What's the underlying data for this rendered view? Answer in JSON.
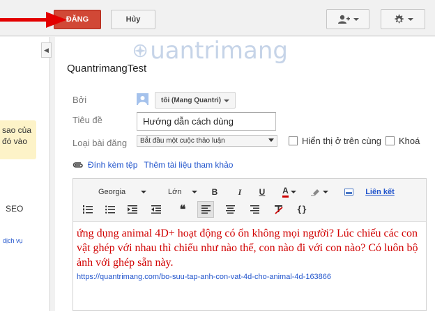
{
  "topbar": {
    "post_label": "ĐĂNG",
    "cancel_label": "Hủy"
  },
  "left": {
    "note_text": "sao của đó vào",
    "seo_text": "SEO",
    "service_text": "dịch vụ"
  },
  "watermark": {
    "text": "uantrimang"
  },
  "group_title": "QuantrimangTest",
  "form": {
    "by_label": "Bởi",
    "author_value": "tôi (Mang Quantri)",
    "title_label": "Tiêu đề",
    "title_value": "Hướng dẫn cách dùng",
    "type_label": "Loại bài đăng",
    "type_value": "Bắt đầu một cuộc thảo luận",
    "pin_label": "Hiển thị ở trên cùng",
    "lock_label": "Khoá",
    "attach_label": "Đính kèm tệp",
    "add_resource_label": "Thêm tài liệu tham khảo"
  },
  "toolbar": {
    "font_family": "Georgia",
    "font_size": "Lớn",
    "bold": "B",
    "italic": "I",
    "underline": "U",
    "text_color": "A",
    "link": "Liên kết",
    "quote": "❝",
    "code": "{}"
  },
  "editor": {
    "body_text": "ứng dụng animal 4D+ hoạt động có ổn không mọi người? Lúc chiếu các con vật ghép với nhau thì chiếu như nào thế, con nào đi với con nào? Có luôn bộ ảnh với ghép sẵn này.",
    "body_link": "https://quantrimang.com/bo-suu-tap-anh-con-vat-4d-cho-animal-4d-163866"
  },
  "colors": {
    "post_button": "#d14836",
    "arrow": "#e30000",
    "body_text": "#d10000",
    "link": "#2255cc"
  },
  "icons": [
    "arrow-right-icon",
    "add-person-icon",
    "gear-icon",
    "chevron-left-icon",
    "avatar-icon",
    "paperclip-icon",
    "numbered-list-icon",
    "bulleted-list-icon",
    "indent-icon",
    "outdent-icon",
    "quote-icon",
    "align-left-icon",
    "align-center-icon",
    "align-right-icon",
    "clear-format-icon",
    "code-icon",
    "highlight-icon",
    "image-icon"
  ]
}
